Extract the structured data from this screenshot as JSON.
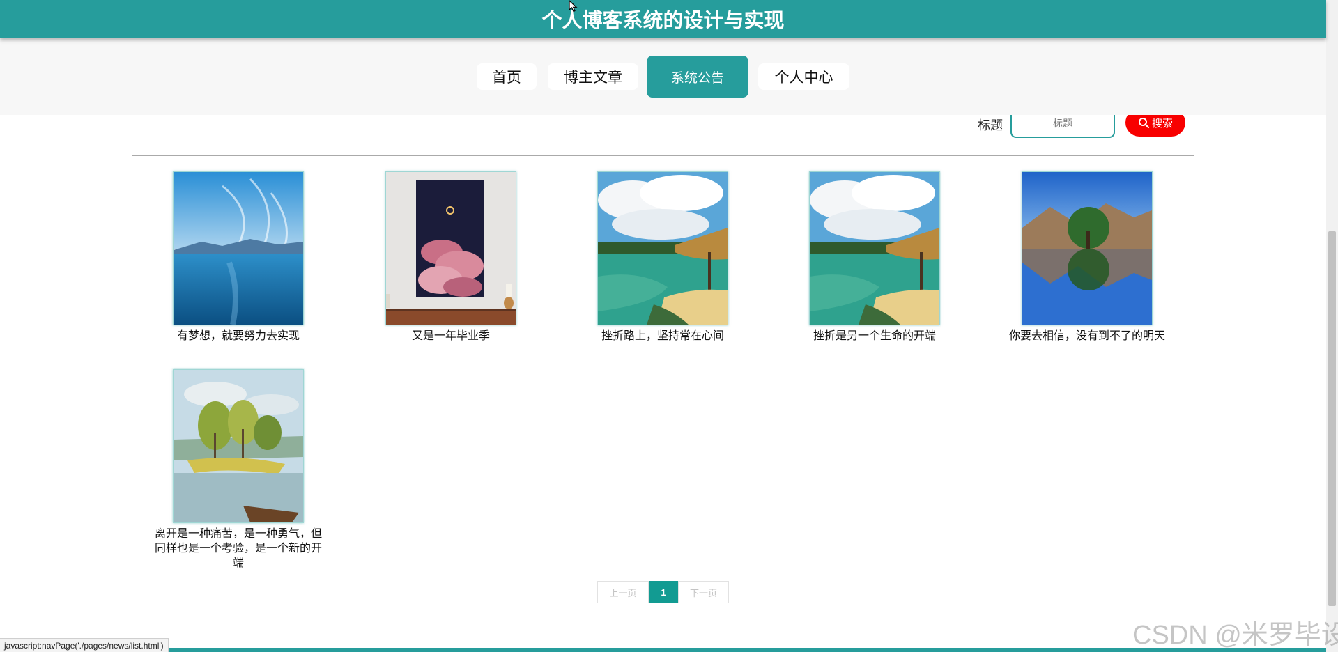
{
  "header": {
    "title": "个人博客系统的设计与实现"
  },
  "nav": [
    {
      "label": "首页",
      "active": false
    },
    {
      "label": "博主文章",
      "active": false
    },
    {
      "label": "系统公告",
      "active": true
    },
    {
      "label": "个人中心",
      "active": false
    }
  ],
  "search": {
    "label": "标题",
    "placeholder": "标题",
    "button_label": "搜索"
  },
  "items": [
    {
      "caption": "有梦想，就要努力去实现",
      "image": "lake-sky-icon"
    },
    {
      "caption": "又是一年毕业季",
      "image": "pink-cloud-painting-icon"
    },
    {
      "caption": "挫折路上，坚持常在心间",
      "image": "tropical-beach-icon"
    },
    {
      "caption": "挫折是另一个生命的开端",
      "image": "tropical-beach-icon"
    },
    {
      "caption": "你要去相信，没有到不了的明天",
      "image": "mountain-lake-icon"
    },
    {
      "caption": "离开是一种痛苦，是一种勇气，但同样也是一个考验，是一个新的开端",
      "image": "lake-painting-icon"
    }
  ],
  "pagination": {
    "prev_label": "上一页",
    "current": "1",
    "next_label": "下一页"
  },
  "status_url": "javascript:navPage('./pages/news/list.html')",
  "watermark": "CSDN @米罗毕设",
  "colors": {
    "primary": "#269d9c",
    "search_button": "#f80000",
    "pager_active": "#129b92"
  }
}
